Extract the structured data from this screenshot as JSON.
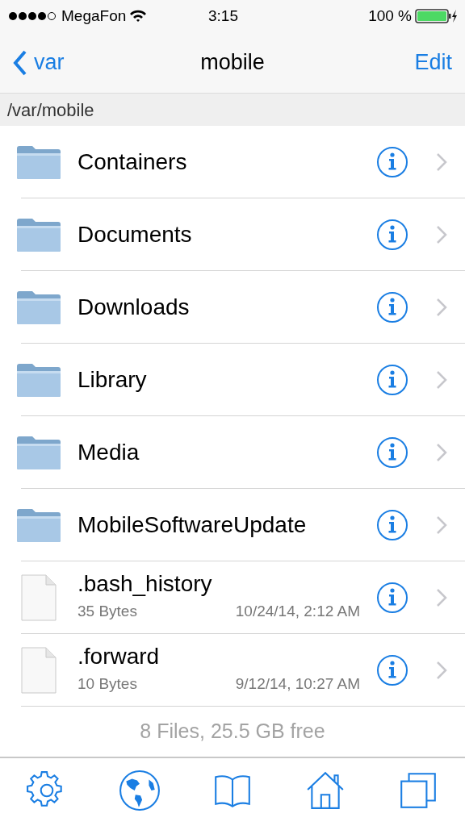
{
  "status_bar": {
    "carrier": "MegaFon",
    "time": "3:15",
    "battery": "100 %"
  },
  "nav": {
    "back": "var",
    "title": "mobile",
    "action": "Edit"
  },
  "path": "/var/mobile",
  "items": [
    {
      "kind": "folder",
      "name": "Containers"
    },
    {
      "kind": "folder",
      "name": "Documents"
    },
    {
      "kind": "folder",
      "name": "Downloads"
    },
    {
      "kind": "folder",
      "name": "Library"
    },
    {
      "kind": "folder",
      "name": "Media"
    },
    {
      "kind": "folder",
      "name": "MobileSoftwareUpdate"
    },
    {
      "kind": "file",
      "name": ".bash_history",
      "size": "35 Bytes",
      "date": "10/24/14, 2:12 AM"
    },
    {
      "kind": "file",
      "name": ".forward",
      "size": "10 Bytes",
      "date": "9/12/14, 10:27 AM"
    }
  ],
  "summary": "8 Files, 25.5 GB free",
  "tab_bar": [
    {
      "kind": "settings"
    },
    {
      "kind": "globe"
    },
    {
      "kind": "book"
    },
    {
      "kind": "home"
    },
    {
      "kind": "windows"
    }
  ]
}
